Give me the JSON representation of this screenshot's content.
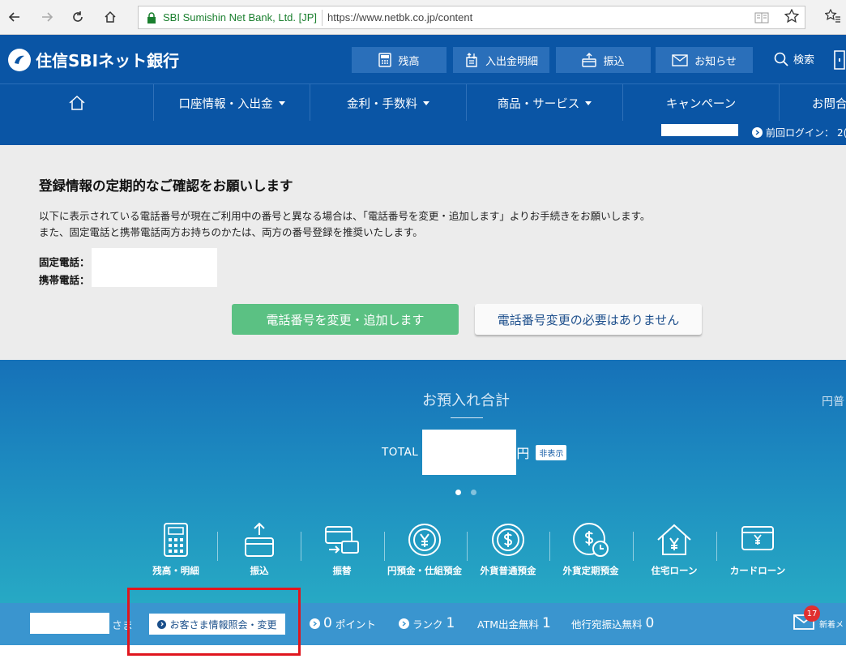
{
  "browser": {
    "site_identity": "SBI Sumishin Net Bank, Ltd. [JP]",
    "url": "https://www.netbk.co.jp/content"
  },
  "header": {
    "logo_text": "住信SBIネット銀行",
    "buttons": [
      {
        "label": "残高",
        "icon": "calculator-icon"
      },
      {
        "label": "入出金明細",
        "icon": "statement-icon"
      },
      {
        "label": "振込",
        "icon": "transfer-icon"
      },
      {
        "label": "お知らせ",
        "icon": "mail-icon"
      }
    ],
    "search_label": "検索",
    "colors": {
      "primary": "#0a55a5",
      "accent_green": "#5bc183"
    }
  },
  "nav": {
    "items": [
      {
        "label": "",
        "icon": "home-icon"
      },
      {
        "label": "口座情報・入出金",
        "dropdown": true
      },
      {
        "label": "金利・手数料",
        "dropdown": true
      },
      {
        "label": "商品・サービス",
        "dropdown": true
      },
      {
        "label": "キャンペーン",
        "dropdown": false
      },
      {
        "label": "お問合",
        "dropdown": false
      }
    ]
  },
  "subbar": {
    "last_login_label": "前回ログイン：",
    "last_login_value": "2("
  },
  "notice": {
    "title": "登録情報の定期的なご確認をお願いします",
    "line1": "以下に表示されている電話番号が現在ご利用中の番号と異なる場合は、「電話番号を変更・追加します」よりお手続きをお願いします。",
    "line2": "また、固定電話と携帯電話両方お持ちのかたは、両方の番号登録を推奨いたします。",
    "landline_label": "固定電話：",
    "mobile_label": "携帯電話：",
    "change_button": "電話番号を変更・追加します",
    "no_change_button": "電話番号変更の必要はありません"
  },
  "balance": {
    "title": "お預入れ合計",
    "total_label": "TOTAL",
    "currency": "円",
    "hide_label": "非表示",
    "next_panel_label": "円普",
    "carousel_pages": 2,
    "carousel_active": 1
  },
  "quick_links": [
    {
      "label": "残高・明細",
      "icon": "calculator-icon"
    },
    {
      "label": "振込",
      "icon": "transfer-icon"
    },
    {
      "label": "振替",
      "icon": "card-swap-icon"
    },
    {
      "label": "円預金・仕組預金",
      "icon": "yen-coin-icon"
    },
    {
      "label": "外貨普通預金",
      "icon": "dollar-coin-icon"
    },
    {
      "label": "外貨定期預金",
      "icon": "dollar-clock-icon"
    },
    {
      "label": "住宅ローン",
      "icon": "house-yen-icon"
    },
    {
      "label": "カードローン",
      "icon": "card-yen-icon"
    }
  ],
  "infobar": {
    "sama": "さま",
    "customer_info_button": "お客さま情報照会・変更",
    "points_value": "0",
    "points_label": "ポイント",
    "rank_label": "ランク",
    "rank_value": "1",
    "atm_label": "ATM出金無料",
    "atm_value": "1",
    "transfer_label": "他行宛振込無料",
    "transfer_value": "0",
    "mail_count": "17",
    "mail_label": "新着メ"
  }
}
